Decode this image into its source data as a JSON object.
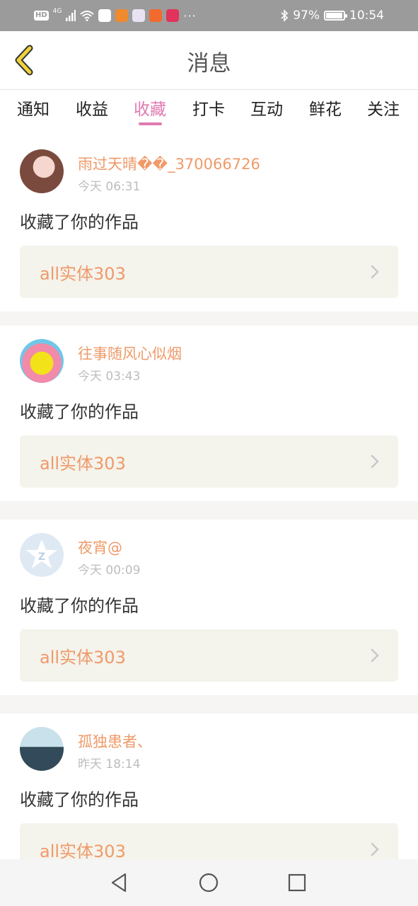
{
  "status_bar": {
    "hd": "HD",
    "network": "4G",
    "battery_percent": "97%",
    "battery_level": 0.97,
    "time": "10:54",
    "overflow": "···"
  },
  "header": {
    "title": "消息",
    "back_icon": "chevron-left-icon"
  },
  "tabs": [
    {
      "label": "通知",
      "active": false
    },
    {
      "label": "收益",
      "active": false
    },
    {
      "label": "收藏",
      "active": true
    },
    {
      "label": "打卡",
      "active": false
    },
    {
      "label": "互动",
      "active": false
    },
    {
      "label": "鲜花",
      "active": false
    },
    {
      "label": "关注",
      "active": false
    }
  ],
  "messages": [
    {
      "user": "雨过天晴��_370066726",
      "time": "今天 06:31",
      "action": "收藏了你的作品",
      "work_title": "all实体303"
    },
    {
      "user": "往事随风心似烟",
      "time": "今天 03:43",
      "action": "收藏了你的作品",
      "work_title": "all实体303"
    },
    {
      "user": "夜宵@",
      "time": "今天 00:09",
      "action": "收藏了你的作品",
      "work_title": "all实体303"
    },
    {
      "user": "孤独患者、",
      "time": "昨天 18:14",
      "action": "收藏了你的作品",
      "work_title": "all实体303"
    }
  ],
  "colors": {
    "accent": "#e07ab0",
    "name": "#ef9a69",
    "work_bg": "#f4f3ec",
    "back_icon": "#f0d23c"
  },
  "nav": {
    "back_icon": "triangle-back-icon",
    "home_icon": "circle-home-icon",
    "recents_icon": "square-recents-icon"
  }
}
